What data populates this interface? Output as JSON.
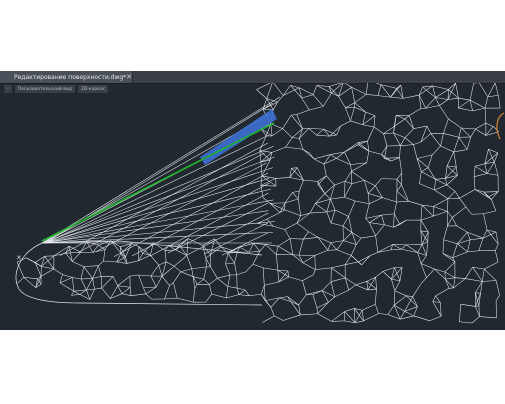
{
  "document_tab": {
    "title": "Редактирование поверхности.dwg*",
    "close_glyph": "✕"
  },
  "viewport_controls": {
    "minus": "-",
    "view": "Пользовательский вид",
    "style": "2D-каркас"
  },
  "colors": {
    "background": "#212830",
    "mesh": "#e8ecef",
    "highlight_blue": "#3d6fd1",
    "highlight_green": "#1fb52b",
    "boundary_orange": "#d2822d"
  },
  "icons": {
    "close": "close-icon",
    "ucs": "ucs-axis-icon"
  }
}
